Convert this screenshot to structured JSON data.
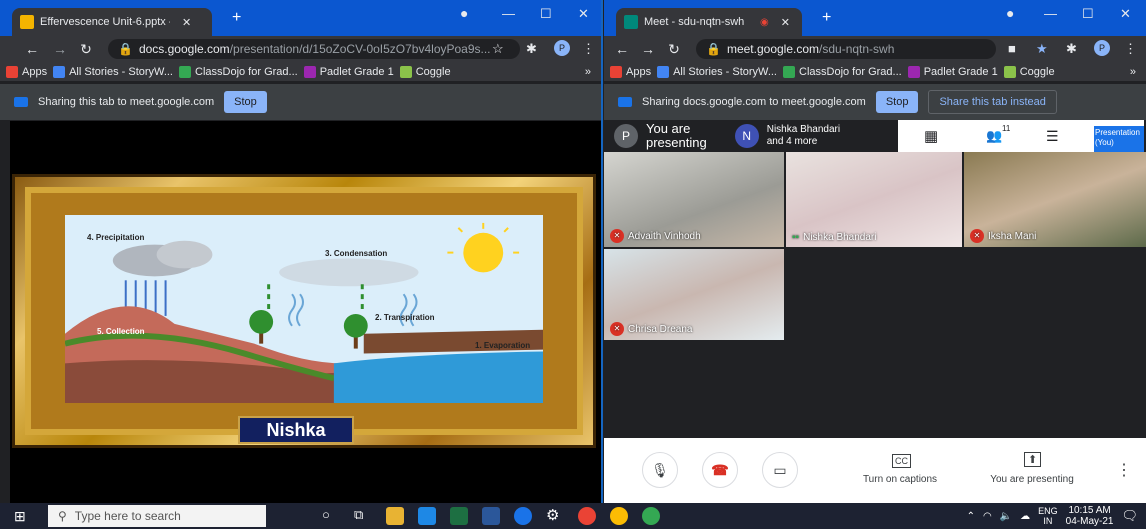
{
  "left": {
    "tab_title": "Effervescence Unit-6.pptx - (",
    "url_host": "docs.google.com",
    "url_path": "/presentation/d/15oZoCV-0oI5zO7bv4loyPoa9s...",
    "share_text": "Sharing this tab to meet.google.com",
    "stop": "Stop"
  },
  "right": {
    "tab_title": "Meet - sdu-nqtn-swh",
    "url_host": "meet.google.com",
    "url_path": "/sdu-nqtn-swh",
    "share_text": "Sharing docs.google.com to meet.google.com",
    "stop": "Stop",
    "share_instead": "Share this tab instead"
  },
  "bookmarks": [
    {
      "label": "Apps",
      "color": "#e94235"
    },
    {
      "label": "All Stories - StoryW...",
      "color": "#4285f4"
    },
    {
      "label": "ClassDojo for Grad...",
      "color": "#34a853"
    },
    {
      "label": "Padlet Grade 1",
      "color": "#9c27b0"
    },
    {
      "label": "Coggle",
      "color": "#8bc34a"
    }
  ],
  "slide": {
    "name": "Nishka",
    "labels": {
      "precip": "4. Precipitation",
      "cond": "3. Condensation",
      "trans": "2. Transpiration",
      "evap": "1. Evaporation",
      "collect": "5. Collection"
    }
  },
  "meet": {
    "presenting_line1": "You are",
    "presenting_line2": "presenting",
    "presenter_initial": "P",
    "nishka_initial": "N",
    "others_line1": "Nishka Bhandari",
    "others_line2": "and 4 more",
    "people_count": "11",
    "presentation_label": "Presentation",
    "you_label": "(You)",
    "tiles": [
      {
        "name": "Advaith Vinhodh",
        "muted": true
      },
      {
        "name": "Nishka Bhandari",
        "muted": false
      },
      {
        "name": "Iksha Mani",
        "muted": true
      },
      {
        "name": "Chrisa Dreana",
        "muted": true
      }
    ],
    "captions": "Turn on captions",
    "you_presenting": "You are presenting"
  },
  "taskbar": {
    "search": "Type here to search",
    "lang1": "ENG",
    "lang2": "IN",
    "time": "10:15 AM",
    "date": "04-May-21"
  }
}
